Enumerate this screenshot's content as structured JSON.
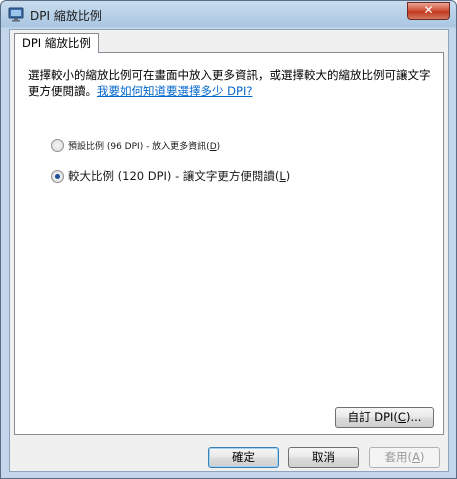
{
  "window": {
    "title": "DPI 縮放比例",
    "close_glyph": "✕"
  },
  "tab": {
    "label": "DPI 縮放比例"
  },
  "description": {
    "text": "選擇較小的縮放比例可在畫面中放入更多資訊，或選擇較大的縮放比例可讓文字更方便閱讀。",
    "link": "我要如何知道要選擇多少 DPI?"
  },
  "options": [
    {
      "label_pre": "預設比例 (96 DPI) - 放入更多資訊(",
      "accel": "D",
      "label_post": ")",
      "checked": false
    },
    {
      "label_pre": "較大比例 (120 DPI) - 讓文字更方便閱讀(",
      "accel": "L",
      "label_post": ")",
      "checked": true
    }
  ],
  "buttons": {
    "custom_pre": "自訂 DPI(",
    "custom_accel": "C",
    "custom_post": ")...",
    "ok": "確定",
    "cancel": "取消",
    "apply_pre": "套用(",
    "apply_accel": "A",
    "apply_post": ")"
  },
  "colors": {
    "link": "#0066cc",
    "radio_dot": "#1a4f9c",
    "close_button": "#c23a1e"
  },
  "icons": {
    "app": "monitor-icon",
    "close": "close-icon"
  }
}
